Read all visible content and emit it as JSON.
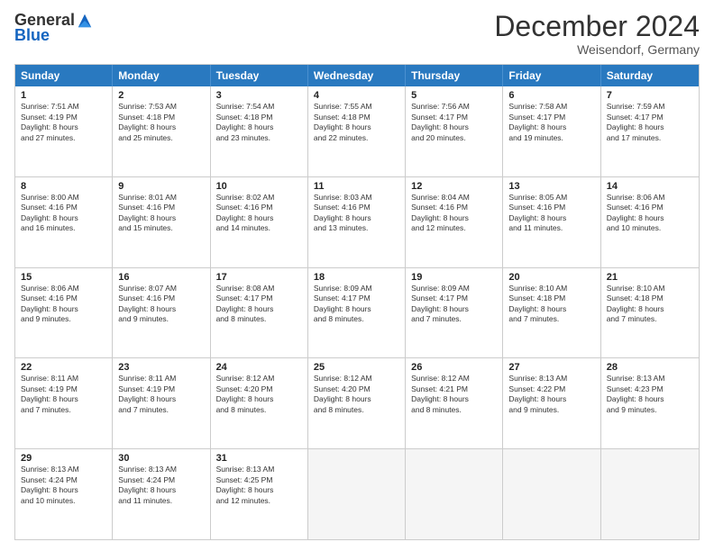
{
  "logo": {
    "general": "General",
    "blue": "Blue"
  },
  "title": "December 2024",
  "subtitle": "Weisendorf, Germany",
  "days": [
    "Sunday",
    "Monday",
    "Tuesday",
    "Wednesday",
    "Thursday",
    "Friday",
    "Saturday"
  ],
  "rows": [
    [
      {
        "day": "1",
        "text": "Sunrise: 7:51 AM\nSunset: 4:19 PM\nDaylight: 8 hours\nand 27 minutes."
      },
      {
        "day": "2",
        "text": "Sunrise: 7:53 AM\nSunset: 4:18 PM\nDaylight: 8 hours\nand 25 minutes."
      },
      {
        "day": "3",
        "text": "Sunrise: 7:54 AM\nSunset: 4:18 PM\nDaylight: 8 hours\nand 23 minutes."
      },
      {
        "day": "4",
        "text": "Sunrise: 7:55 AM\nSunset: 4:18 PM\nDaylight: 8 hours\nand 22 minutes."
      },
      {
        "day": "5",
        "text": "Sunrise: 7:56 AM\nSunset: 4:17 PM\nDaylight: 8 hours\nand 20 minutes."
      },
      {
        "day": "6",
        "text": "Sunrise: 7:58 AM\nSunset: 4:17 PM\nDaylight: 8 hours\nand 19 minutes."
      },
      {
        "day": "7",
        "text": "Sunrise: 7:59 AM\nSunset: 4:17 PM\nDaylight: 8 hours\nand 17 minutes."
      }
    ],
    [
      {
        "day": "8",
        "text": "Sunrise: 8:00 AM\nSunset: 4:16 PM\nDaylight: 8 hours\nand 16 minutes."
      },
      {
        "day": "9",
        "text": "Sunrise: 8:01 AM\nSunset: 4:16 PM\nDaylight: 8 hours\nand 15 minutes."
      },
      {
        "day": "10",
        "text": "Sunrise: 8:02 AM\nSunset: 4:16 PM\nDaylight: 8 hours\nand 14 minutes."
      },
      {
        "day": "11",
        "text": "Sunrise: 8:03 AM\nSunset: 4:16 PM\nDaylight: 8 hours\nand 13 minutes."
      },
      {
        "day": "12",
        "text": "Sunrise: 8:04 AM\nSunset: 4:16 PM\nDaylight: 8 hours\nand 12 minutes."
      },
      {
        "day": "13",
        "text": "Sunrise: 8:05 AM\nSunset: 4:16 PM\nDaylight: 8 hours\nand 11 minutes."
      },
      {
        "day": "14",
        "text": "Sunrise: 8:06 AM\nSunset: 4:16 PM\nDaylight: 8 hours\nand 10 minutes."
      }
    ],
    [
      {
        "day": "15",
        "text": "Sunrise: 8:06 AM\nSunset: 4:16 PM\nDaylight: 8 hours\nand 9 minutes."
      },
      {
        "day": "16",
        "text": "Sunrise: 8:07 AM\nSunset: 4:16 PM\nDaylight: 8 hours\nand 9 minutes."
      },
      {
        "day": "17",
        "text": "Sunrise: 8:08 AM\nSunset: 4:17 PM\nDaylight: 8 hours\nand 8 minutes."
      },
      {
        "day": "18",
        "text": "Sunrise: 8:09 AM\nSunset: 4:17 PM\nDaylight: 8 hours\nand 8 minutes."
      },
      {
        "day": "19",
        "text": "Sunrise: 8:09 AM\nSunset: 4:17 PM\nDaylight: 8 hours\nand 7 minutes."
      },
      {
        "day": "20",
        "text": "Sunrise: 8:10 AM\nSunset: 4:18 PM\nDaylight: 8 hours\nand 7 minutes."
      },
      {
        "day": "21",
        "text": "Sunrise: 8:10 AM\nSunset: 4:18 PM\nDaylight: 8 hours\nand 7 minutes."
      }
    ],
    [
      {
        "day": "22",
        "text": "Sunrise: 8:11 AM\nSunset: 4:19 PM\nDaylight: 8 hours\nand 7 minutes."
      },
      {
        "day": "23",
        "text": "Sunrise: 8:11 AM\nSunset: 4:19 PM\nDaylight: 8 hours\nand 7 minutes."
      },
      {
        "day": "24",
        "text": "Sunrise: 8:12 AM\nSunset: 4:20 PM\nDaylight: 8 hours\nand 8 minutes."
      },
      {
        "day": "25",
        "text": "Sunrise: 8:12 AM\nSunset: 4:20 PM\nDaylight: 8 hours\nand 8 minutes."
      },
      {
        "day": "26",
        "text": "Sunrise: 8:12 AM\nSunset: 4:21 PM\nDaylight: 8 hours\nand 8 minutes."
      },
      {
        "day": "27",
        "text": "Sunrise: 8:13 AM\nSunset: 4:22 PM\nDaylight: 8 hours\nand 9 minutes."
      },
      {
        "day": "28",
        "text": "Sunrise: 8:13 AM\nSunset: 4:23 PM\nDaylight: 8 hours\nand 9 minutes."
      }
    ],
    [
      {
        "day": "29",
        "text": "Sunrise: 8:13 AM\nSunset: 4:24 PM\nDaylight: 8 hours\nand 10 minutes."
      },
      {
        "day": "30",
        "text": "Sunrise: 8:13 AM\nSunset: 4:24 PM\nDaylight: 8 hours\nand 11 minutes."
      },
      {
        "day": "31",
        "text": "Sunrise: 8:13 AM\nSunset: 4:25 PM\nDaylight: 8 hours\nand 12 minutes."
      },
      {
        "day": "",
        "text": ""
      },
      {
        "day": "",
        "text": ""
      },
      {
        "day": "",
        "text": ""
      },
      {
        "day": "",
        "text": ""
      }
    ]
  ]
}
